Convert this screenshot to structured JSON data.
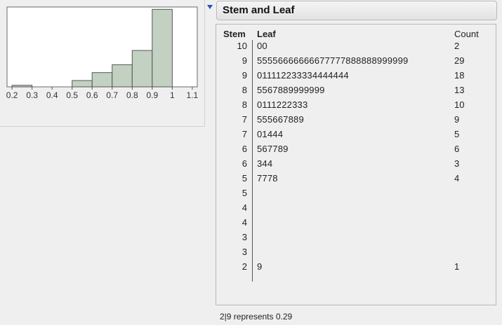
{
  "histogram": {
    "x_ticks": [
      "0.2",
      "0.3",
      "0.4",
      "0.5",
      "0.6",
      "0.7",
      "0.8",
      "0.9",
      "1",
      "1.1"
    ],
    "bins": [
      {
        "lo": 0.2,
        "hi": 0.3,
        "count": 1
      },
      {
        "lo": 0.5,
        "hi": 0.6,
        "count": 4
      },
      {
        "lo": 0.6,
        "hi": 0.7,
        "count": 9
      },
      {
        "lo": 0.7,
        "hi": 0.8,
        "count": 14
      },
      {
        "lo": 0.8,
        "hi": 0.9,
        "count": 23
      },
      {
        "lo": 0.9,
        "hi": 1.0,
        "count": 49
      }
    ],
    "bar_color": "#c3d1c3",
    "bar_stroke": "#555555"
  },
  "outline": {
    "title": "Stem and Leaf"
  },
  "table": {
    "headers": {
      "stem": "Stem",
      "leaf": "Leaf",
      "count": "Count"
    },
    "rows": [
      {
        "stem": "10",
        "leaf": "00",
        "count": "2"
      },
      {
        "stem": "9",
        "leaf": "55556666666677777888888999999",
        "count": "29"
      },
      {
        "stem": "9",
        "leaf": "011112233334444444",
        "count": "18"
      },
      {
        "stem": "8",
        "leaf": "5567889999999",
        "count": "13"
      },
      {
        "stem": "8",
        "leaf": "0111222333",
        "count": "10"
      },
      {
        "stem": "7",
        "leaf": "555667889",
        "count": "9"
      },
      {
        "stem": "7",
        "leaf": "01444",
        "count": "5"
      },
      {
        "stem": "6",
        "leaf": "567789",
        "count": "6"
      },
      {
        "stem": "6",
        "leaf": "344",
        "count": "3"
      },
      {
        "stem": "5",
        "leaf": "7778",
        "count": "4"
      },
      {
        "stem": "5",
        "leaf": "",
        "count": ""
      },
      {
        "stem": "4",
        "leaf": "",
        "count": ""
      },
      {
        "stem": "4",
        "leaf": "",
        "count": ""
      },
      {
        "stem": "3",
        "leaf": "",
        "count": ""
      },
      {
        "stem": "3",
        "leaf": "",
        "count": ""
      },
      {
        "stem": "2",
        "leaf": "9",
        "count": "1"
      }
    ]
  },
  "footnote": "2|9 represents 0.29"
}
